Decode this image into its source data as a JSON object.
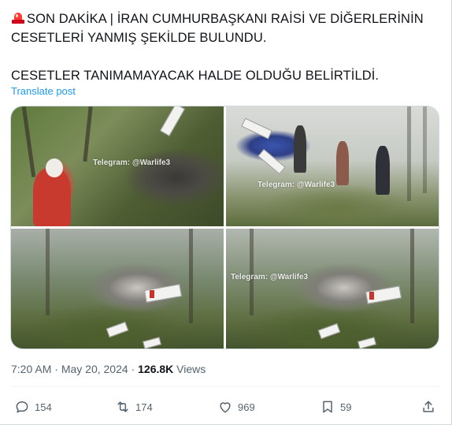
{
  "tweet": {
    "line1": "SON DAKİKA | İRAN CUMHURBAŞKANI RAİSİ VE DİĞERLERİNİN",
    "line2": "CESETLERİ YANMIŞ ŞEKİLDE BULUNDU.",
    "line3": "CESETLER TANIMAMAYACAK HALDE OLDUĞU BELİRTİLDİ.",
    "translate_label": "Translate post",
    "leading_icon": "siren-emoji"
  },
  "media": {
    "watermark_1": "Telegram: @Warlife3",
    "watermark_2": "Telegram: @Warlife3",
    "watermark_3": "Telegram: @Warlife3"
  },
  "meta": {
    "time": "7:20 AM",
    "separator": " · ",
    "date": "May 20, 2024",
    "views_count": "126.8K",
    "views_label": " Views"
  },
  "actions": {
    "replies": "154",
    "reposts": "174",
    "likes": "969",
    "bookmarks": "59"
  },
  "colors": {
    "link": "#1d9bf0",
    "secondary_text": "#536471",
    "primary_text": "#0f1419"
  }
}
